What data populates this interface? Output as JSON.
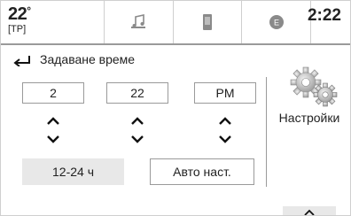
{
  "status_bar": {
    "temperature": "22",
    "temperature_unit": "°",
    "temperature_zone": "[TP]",
    "tabs": [
      {
        "icon": "music-note-icon"
      },
      {
        "icon": "phone-icon"
      },
      {
        "icon": "e-circle-icon",
        "label": "E"
      }
    ],
    "clock": "2:22"
  },
  "header": {
    "title": "Задаване време",
    "back_icon": "back-arrow-icon"
  },
  "time_setting": {
    "hour": "2",
    "minute": "22",
    "period": "PM"
  },
  "buttons": {
    "format_label": "12-24 ч",
    "auto_label": "Авто наст."
  },
  "settings": {
    "label": "Настройки",
    "icon": "gears-icon"
  },
  "colors": {
    "border": "#9a9a9a",
    "button_fill": "#e8e8e8",
    "icon_gray": "#8a8a8a"
  }
}
